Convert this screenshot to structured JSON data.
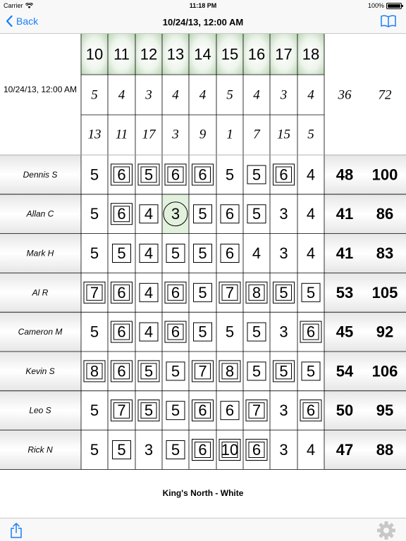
{
  "status_bar": {
    "carrier": "Carrier",
    "time": "11:18 PM",
    "battery": "100%"
  },
  "nav": {
    "back_label": "Back",
    "title": "10/24/13, 12:00 AM"
  },
  "round_date": "10/24/13, 12:00 AM",
  "course_name": "King's North - White",
  "colors": {
    "accent": "#157efb",
    "green_tint": "#e2f1dd",
    "hole_header_green": "#cfe3cb",
    "grid_line": "#000000"
  },
  "icons": {
    "back": "chevron-left-icon",
    "book": "book-icon",
    "share": "share-icon",
    "settings": "gear-icon"
  },
  "scorecard": {
    "holes": [
      10,
      11,
      12,
      13,
      14,
      15,
      16,
      17,
      18
    ],
    "par": [
      5,
      4,
      3,
      4,
      4,
      5,
      4,
      3,
      4
    ],
    "par_total": 36,
    "par_round_total": 72,
    "handicap": [
      13,
      11,
      17,
      3,
      9,
      1,
      7,
      15,
      5
    ],
    "players": [
      {
        "name": "Dennis S",
        "scores": [
          5,
          6,
          5,
          6,
          6,
          5,
          5,
          6,
          4
        ],
        "total": 48,
        "round_total": 100
      },
      {
        "name": "Allan C",
        "scores": [
          5,
          6,
          4,
          3,
          5,
          6,
          5,
          3,
          4
        ],
        "total": 41,
        "round_total": 86
      },
      {
        "name": "Mark H",
        "scores": [
          5,
          5,
          4,
          5,
          5,
          6,
          4,
          3,
          4
        ],
        "total": 41,
        "round_total": 83
      },
      {
        "name": "Al R",
        "scores": [
          7,
          6,
          4,
          6,
          5,
          7,
          8,
          5,
          5
        ],
        "total": 53,
        "round_total": 105
      },
      {
        "name": "Cameron M",
        "scores": [
          5,
          6,
          4,
          6,
          5,
          5,
          5,
          3,
          6
        ],
        "total": 45,
        "round_total": 92
      },
      {
        "name": "Kevin S",
        "scores": [
          8,
          6,
          5,
          5,
          7,
          8,
          5,
          5,
          5
        ],
        "total": 54,
        "round_total": 106
      },
      {
        "name": "Leo S",
        "scores": [
          5,
          7,
          5,
          5,
          6,
          6,
          7,
          3,
          6
        ],
        "total": 50,
        "round_total": 95
      },
      {
        "name": "Rick N",
        "scores": [
          5,
          5,
          3,
          5,
          6,
          10,
          6,
          3,
          4
        ],
        "total": 47,
        "round_total": 88
      }
    ]
  }
}
